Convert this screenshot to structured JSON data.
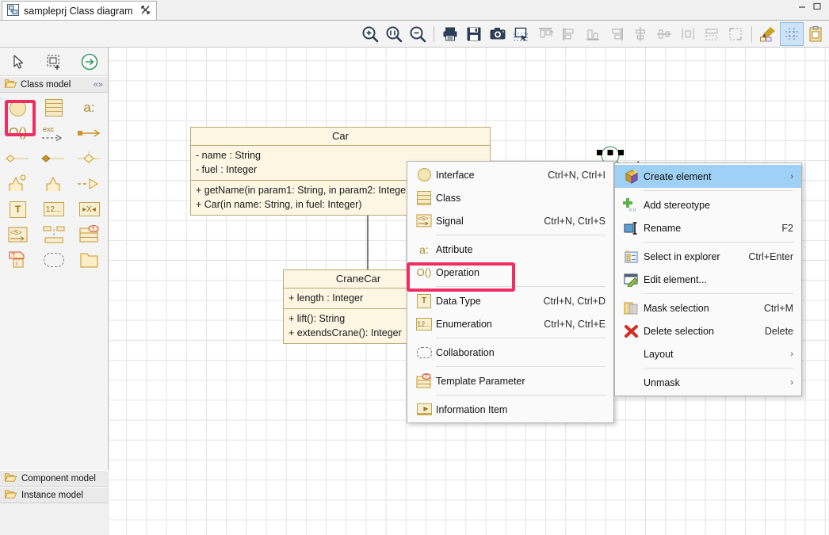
{
  "window": {
    "tab_title": "sampleprj Class diagram",
    "tab_close_glyph": "✕",
    "diagram_icon": "class-diagram-icon"
  },
  "toolbar": {
    "items": [
      {
        "name": "zoom-in-icon",
        "glyph": "zoom-in",
        "title": "Zoom in"
      },
      {
        "name": "zoom-fit-icon",
        "glyph": "zoom-fit",
        "title": "Zoom 1:1"
      },
      {
        "name": "zoom-out-icon",
        "glyph": "zoom-out",
        "title": "Zoom out"
      },
      {
        "name": "print-icon",
        "glyph": "print",
        "title": "Print"
      },
      {
        "name": "save-icon",
        "glyph": "save",
        "title": "Save"
      },
      {
        "name": "snapshot-icon",
        "glyph": "camera",
        "title": "Snapshot"
      },
      {
        "name": "select-region-icon",
        "glyph": "select",
        "title": "Select"
      },
      {
        "name": "align-top-icon",
        "glyph": "align-top",
        "title": "Align top"
      },
      {
        "name": "align-left-icon",
        "glyph": "align-left",
        "title": "Align left"
      },
      {
        "name": "align-bottom-icon",
        "glyph": "align-bottom",
        "title": "Align bottom"
      },
      {
        "name": "align-right-icon",
        "glyph": "align-right",
        "title": "Align right"
      },
      {
        "name": "align-center-v-icon",
        "glyph": "center-v",
        "title": "Center vertically"
      },
      {
        "name": "align-center-h-icon",
        "glyph": "center-h",
        "title": "Center horizontally"
      },
      {
        "name": "distribute-h-icon",
        "glyph": "dist-h",
        "title": "Distribute horizontally"
      },
      {
        "name": "same-size-icon",
        "glyph": "same-size",
        "title": "Same size"
      },
      {
        "name": "fit-to-content-icon",
        "glyph": "fit-content",
        "title": "Fit to content"
      },
      {
        "name": "format-painter-icon",
        "glyph": "painter",
        "title": "Format painter"
      },
      {
        "name": "toggle-grid-icon",
        "glyph": "grid",
        "title": "Show grid",
        "active": true
      },
      {
        "name": "clipboard-icon",
        "glyph": "clipboard",
        "title": "Paste style"
      }
    ]
  },
  "palette": {
    "top_tools": [
      {
        "name": "pointer-tool",
        "glyph": "cursor"
      },
      {
        "name": "marquee-select-tool",
        "glyph": "marquee"
      },
      {
        "name": "navigate-tool",
        "glyph": "arrow-circle"
      }
    ],
    "section_label": "Class model",
    "section_icon": "folder-icon",
    "collapse_icon": "collapse-icon",
    "tools": [
      {
        "name": "interface-tool",
        "kind": "circle",
        "label": "Interface",
        "highlighted": true
      },
      {
        "name": "class-tool",
        "kind": "class",
        "label": "Class"
      },
      {
        "name": "attribute-tool",
        "kind": "text",
        "text": "a:",
        "label": "Attribute"
      },
      {
        "name": "operation-tool",
        "kind": "text",
        "text": "O()",
        "label": "Operation"
      },
      {
        "name": "exception-tool",
        "kind": "exc",
        "text": "exc",
        "label": "Raised exception"
      },
      {
        "name": "association-tool",
        "kind": "assoc",
        "label": "Association"
      },
      {
        "name": "aggregation-tool",
        "kind": "aggregation",
        "label": "Aggregation"
      },
      {
        "name": "composition-tool",
        "kind": "composition",
        "label": "Composition"
      },
      {
        "name": "association-class-tool",
        "kind": "assoc-class",
        "label": "Association class"
      },
      {
        "name": "generalization-note-tool",
        "kind": "gen-note",
        "label": "Generalization"
      },
      {
        "name": "generalization-tool",
        "kind": "gen",
        "label": "Generalization"
      },
      {
        "name": "realization-tool",
        "kind": "realization",
        "label": "Realization"
      },
      {
        "name": "datatype-tool",
        "kind": "boxT",
        "text": "T",
        "label": "Data Type"
      },
      {
        "name": "enumeration-tool",
        "kind": "boxNum",
        "text": "12...",
        "label": "Enumeration"
      },
      {
        "name": "literal-tool",
        "kind": "boxX",
        "text": "X",
        "label": "Enumeration literal"
      },
      {
        "name": "signal-tool",
        "kind": "sig",
        "text": "<S>",
        "label": "Signal"
      },
      {
        "name": "template-binding-tool",
        "kind": "binding",
        "label": "Template binding"
      },
      {
        "name": "template-parameter-tool",
        "kind": "tmplparam",
        "label": "Template Parameter"
      },
      {
        "name": "bound-class-tool",
        "kind": "bound",
        "label": "Bound class"
      },
      {
        "name": "collaboration-tool",
        "kind": "dash",
        "label": "Collaboration"
      },
      {
        "name": "package-tool",
        "kind": "package",
        "label": "Package"
      }
    ],
    "bottom_tabs": [
      {
        "name": "panel-tab-component-model",
        "label": "Component model",
        "icon": "folder-icon"
      },
      {
        "name": "panel-tab-instance-model",
        "label": "Instance model",
        "icon": "folder-icon"
      }
    ]
  },
  "diagram": {
    "classes": [
      {
        "name": "Car",
        "attributes": [
          "- name : String",
          "- fuel : Integer"
        ],
        "operations": [
          "+ getName(in param1: String, in param2: Integer)",
          "+ Car(in name: String, in fuel: Integer)"
        ]
      },
      {
        "name": "CraneCar",
        "attributes": [
          "+ length : Integer"
        ],
        "operations": [
          "+ lift(): String",
          "+ extendsCrane(): Integer"
        ]
      }
    ],
    "interface_element": {
      "label": "Interface",
      "name": "interface-element",
      "selected": true
    },
    "relation": {
      "name": "generalization-link",
      "type": "generalization",
      "from": "CraneCar",
      "to": "Car"
    }
  },
  "create_element_menu": {
    "items": [
      {
        "name": "menu-item-interface",
        "label": "Interface",
        "accel": "Ctrl+N, Ctrl+I",
        "icon": "interface-icon"
      },
      {
        "name": "menu-item-class",
        "label": "Class",
        "accel": "",
        "icon": "class-icon"
      },
      {
        "name": "menu-item-signal",
        "label": "Signal",
        "accel": "Ctrl+N, Ctrl+S",
        "icon": "signal-icon"
      },
      {
        "separator": true
      },
      {
        "name": "menu-item-attribute",
        "label": "Attribute",
        "accel": "",
        "icon": "attribute-icon"
      },
      {
        "name": "menu-item-operation",
        "label": "Operation",
        "accel": "",
        "icon": "operation-icon",
        "highlighted": true
      },
      {
        "separator": true
      },
      {
        "name": "menu-item-data-type",
        "label": "Data Type",
        "accel": "Ctrl+N, Ctrl+D",
        "icon": "datatype-icon"
      },
      {
        "name": "menu-item-enumeration",
        "label": "Enumeration",
        "accel": "Ctrl+N, Ctrl+E",
        "icon": "enumeration-icon"
      },
      {
        "separator": true
      },
      {
        "name": "menu-item-collaboration",
        "label": "Collaboration",
        "accel": "",
        "icon": "collaboration-icon"
      },
      {
        "separator": true
      },
      {
        "name": "menu-item-template-parameter",
        "label": "Template Parameter",
        "accel": "",
        "icon": "template-parameter-icon"
      },
      {
        "separator": true
      },
      {
        "name": "menu-item-information-item",
        "label": "Information Item",
        "accel": "",
        "icon": "information-item-icon"
      }
    ]
  },
  "context_menu": {
    "items": [
      {
        "name": "menu-item-create-element",
        "label": "Create element",
        "accel": "",
        "arrow": "›",
        "icon": "create-element-icon",
        "selected": true
      },
      {
        "separator": true
      },
      {
        "name": "menu-item-add-stereotype",
        "label": "Add stereotype",
        "accel": "",
        "icon": "add-stereotype-icon"
      },
      {
        "name": "menu-item-rename",
        "label": "Rename",
        "accel": "F2",
        "icon": "rename-icon"
      },
      {
        "separator": true
      },
      {
        "name": "menu-item-select-in-explorer",
        "label": "Select in explorer",
        "accel": "Ctrl+Enter",
        "icon": "select-in-explorer-icon"
      },
      {
        "name": "menu-item-edit-element",
        "label": "Edit element...",
        "accel": "",
        "icon": "edit-element-icon"
      },
      {
        "separator": true
      },
      {
        "name": "menu-item-mask-selection",
        "label": "Mask selection",
        "accel": "Ctrl+M",
        "icon": "mask-icon"
      },
      {
        "name": "menu-item-delete-selection",
        "label": "Delete selection",
        "accel": "Delete",
        "icon": "delete-icon"
      },
      {
        "name": "menu-item-layout",
        "label": "Layout",
        "accel": "",
        "arrow": "›",
        "icon": ""
      },
      {
        "separator": true
      },
      {
        "name": "menu-item-unmask",
        "label": "Unmask",
        "accel": "",
        "arrow": "›",
        "icon": ""
      }
    ]
  },
  "colors": {
    "highlight_pink": "#ef2d63",
    "menu_selected_blue": "#9fd0f5",
    "uml_fill": "#fdf6e3",
    "uml_border": "#b9a872",
    "toolbar_active": "#cde3f7"
  }
}
